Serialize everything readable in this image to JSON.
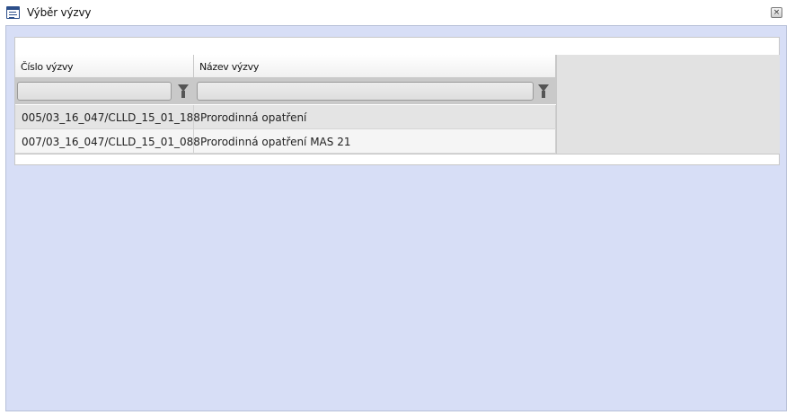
{
  "window": {
    "title": "Výběr výzvy",
    "icon": "list-window-icon",
    "close_icon": "close-icon",
    "close_label": "×"
  },
  "colors": {
    "content_background": "#d7def6",
    "row_odd": "#e4e4e4",
    "row_even": "#f5f5f5",
    "filter_row": "#c9c9c9"
  },
  "table": {
    "columns": [
      {
        "label": "Číslo výzvy",
        "filter_value": "",
        "filter_icon": "filter-funnel-icon"
      },
      {
        "label": "Název výzvy",
        "filter_value": "",
        "filter_icon": "filter-funnel-icon"
      }
    ],
    "rows": [
      {
        "cislo": "005/03_16_047/CLLD_15_01_188",
        "nazev": "Prorodinná opatření"
      },
      {
        "cislo": "007/03_16_047/CLLD_15_01_088",
        "nazev": "Prorodinná opatření MAS 21"
      }
    ]
  }
}
